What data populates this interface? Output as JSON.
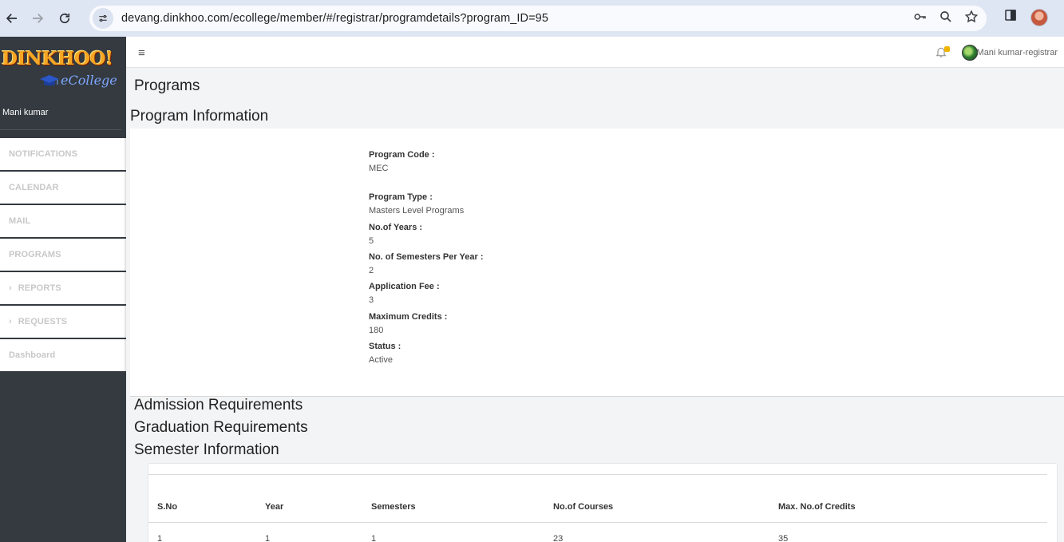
{
  "browser": {
    "url": "devang.dinkhoo.com/ecollege/member/#/registrar/programdetails?program_ID=95"
  },
  "sidebar": {
    "logo_main": "DINKHOO!",
    "logo_sub": "eCollege",
    "user_name": "Mani kumar",
    "items": [
      {
        "label": "NOTIFICATIONS",
        "chevron": ""
      },
      {
        "label": "CALENDAR",
        "chevron": ""
      },
      {
        "label": "MAIL",
        "chevron": ""
      },
      {
        "label": "PROGRAMS",
        "chevron": ""
      },
      {
        "label": "REPORTS",
        "chevron": "›"
      },
      {
        "label": "REQUESTS",
        "chevron": "›"
      },
      {
        "label": "Dashboard",
        "chevron": ""
      }
    ]
  },
  "header": {
    "user_label": "Mani kumar-registrar"
  },
  "main": {
    "page_title": "Programs",
    "section_title": "Program Information",
    "fields": [
      {
        "label": "Program Code :",
        "value": "MEC"
      },
      {
        "label": "Program Type :",
        "value": "Masters Level Programs"
      },
      {
        "label": "No.of Years :",
        "value": "5"
      },
      {
        "label": "No. of Semesters Per Year :",
        "value": "2"
      },
      {
        "label": "Application Fee :",
        "value": "3"
      },
      {
        "label": "Maximum Credits :",
        "value": "180"
      },
      {
        "label": "Status :",
        "value": "Active"
      }
    ],
    "admission_title": "Admission Requirements",
    "graduation_title": "Graduation Requirements",
    "semester_title": "Semester Information",
    "semester_table": {
      "columns": [
        "S.No",
        "Year",
        "Semesters",
        "No.of Courses",
        "Max. No.of Credits"
      ],
      "rows": [
        [
          "1",
          "1",
          "1",
          "23",
          "35"
        ]
      ]
    }
  },
  "colors": {
    "sidebar_bg": "#343a40",
    "chrome_bg": "#dfe6f3",
    "notification_dot": "#f0b400"
  }
}
